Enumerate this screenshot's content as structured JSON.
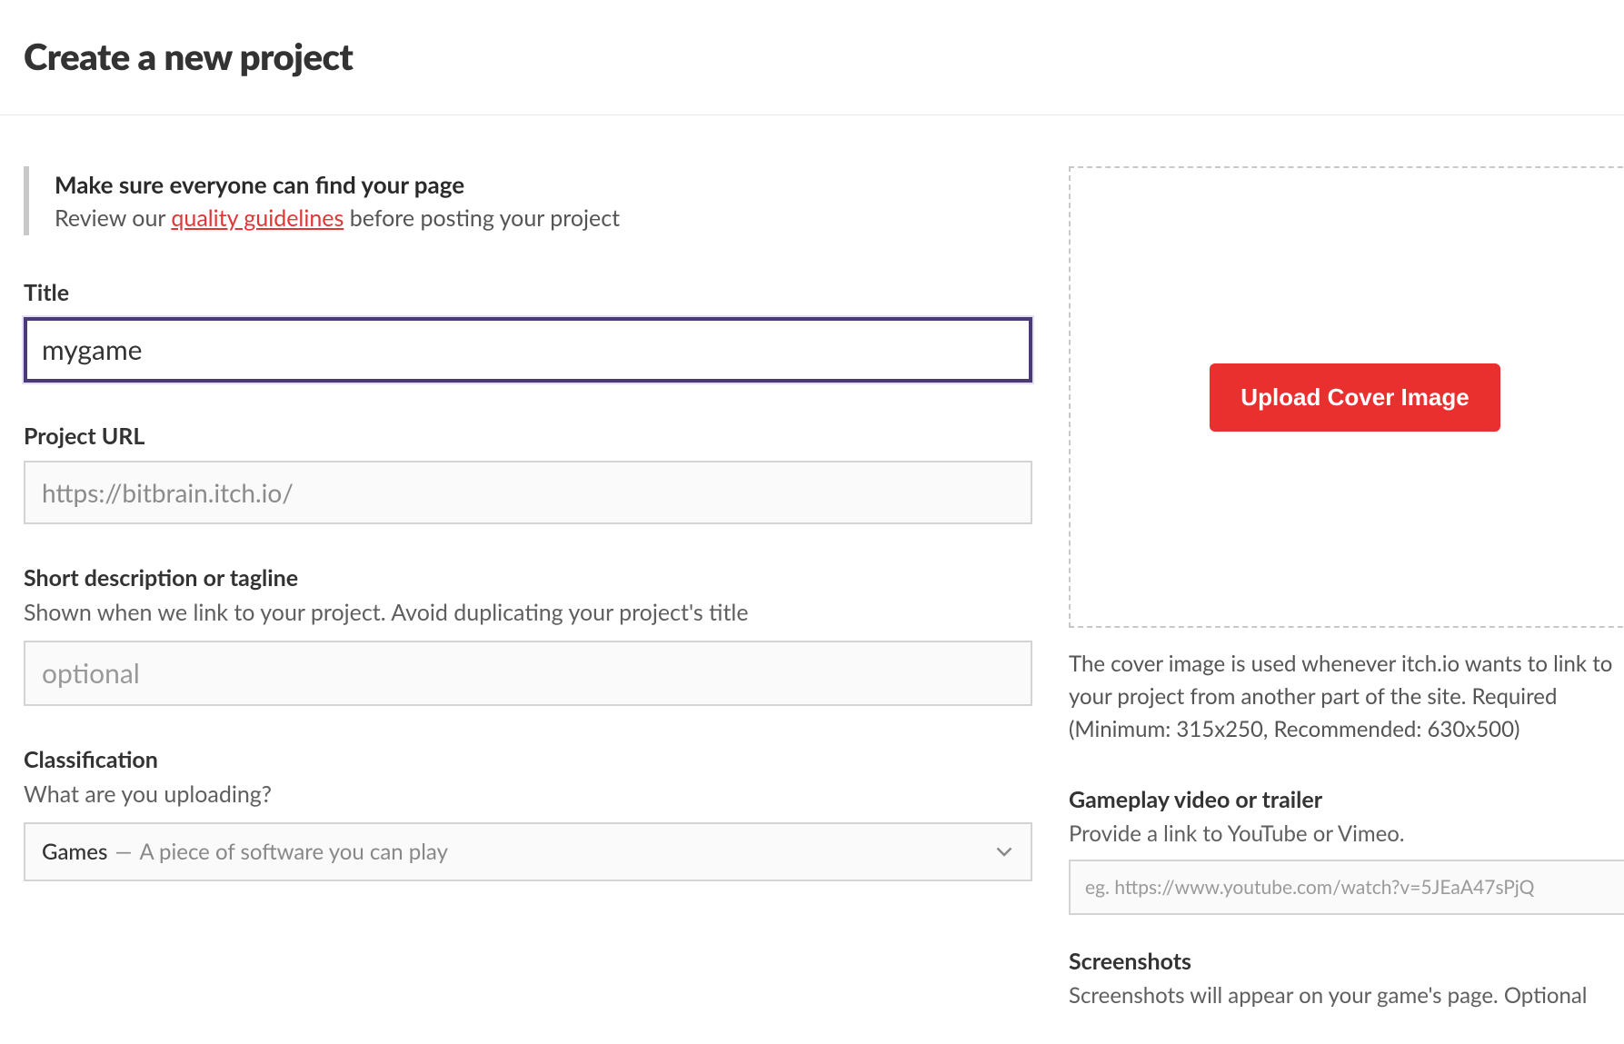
{
  "page": {
    "title": "Create a new project"
  },
  "notice": {
    "heading": "Make sure everyone can find your page",
    "prefix": "Review our ",
    "link_text": "quality guidelines",
    "suffix": " before posting your project"
  },
  "title_field": {
    "label": "Title",
    "value": "mygame"
  },
  "url_field": {
    "label": "Project URL",
    "value": "https://bitbrain.itch.io/"
  },
  "description_field": {
    "label": "Short description or tagline",
    "hint": "Shown when we link to your project. Avoid duplicating your project's title",
    "placeholder": "optional"
  },
  "classification_field": {
    "label": "Classification",
    "hint": "What are you uploading?",
    "selected_main": "Games",
    "selected_sub": "A piece of software you can play"
  },
  "cover": {
    "button": "Upload Cover Image",
    "description": "The cover image is used whenever itch.io wants to link to your project from another part of the site. Required (Minimum: 315x250, Recommended: 630x500)"
  },
  "video": {
    "label": "Gameplay video or trailer",
    "hint": "Provide a link to YouTube or Vimeo.",
    "placeholder": "eg. https://www.youtube.com/watch?v=5JEaA47sPjQ"
  },
  "screenshots": {
    "label": "Screenshots",
    "hint": "Screenshots will appear on your game's page. Optional"
  }
}
